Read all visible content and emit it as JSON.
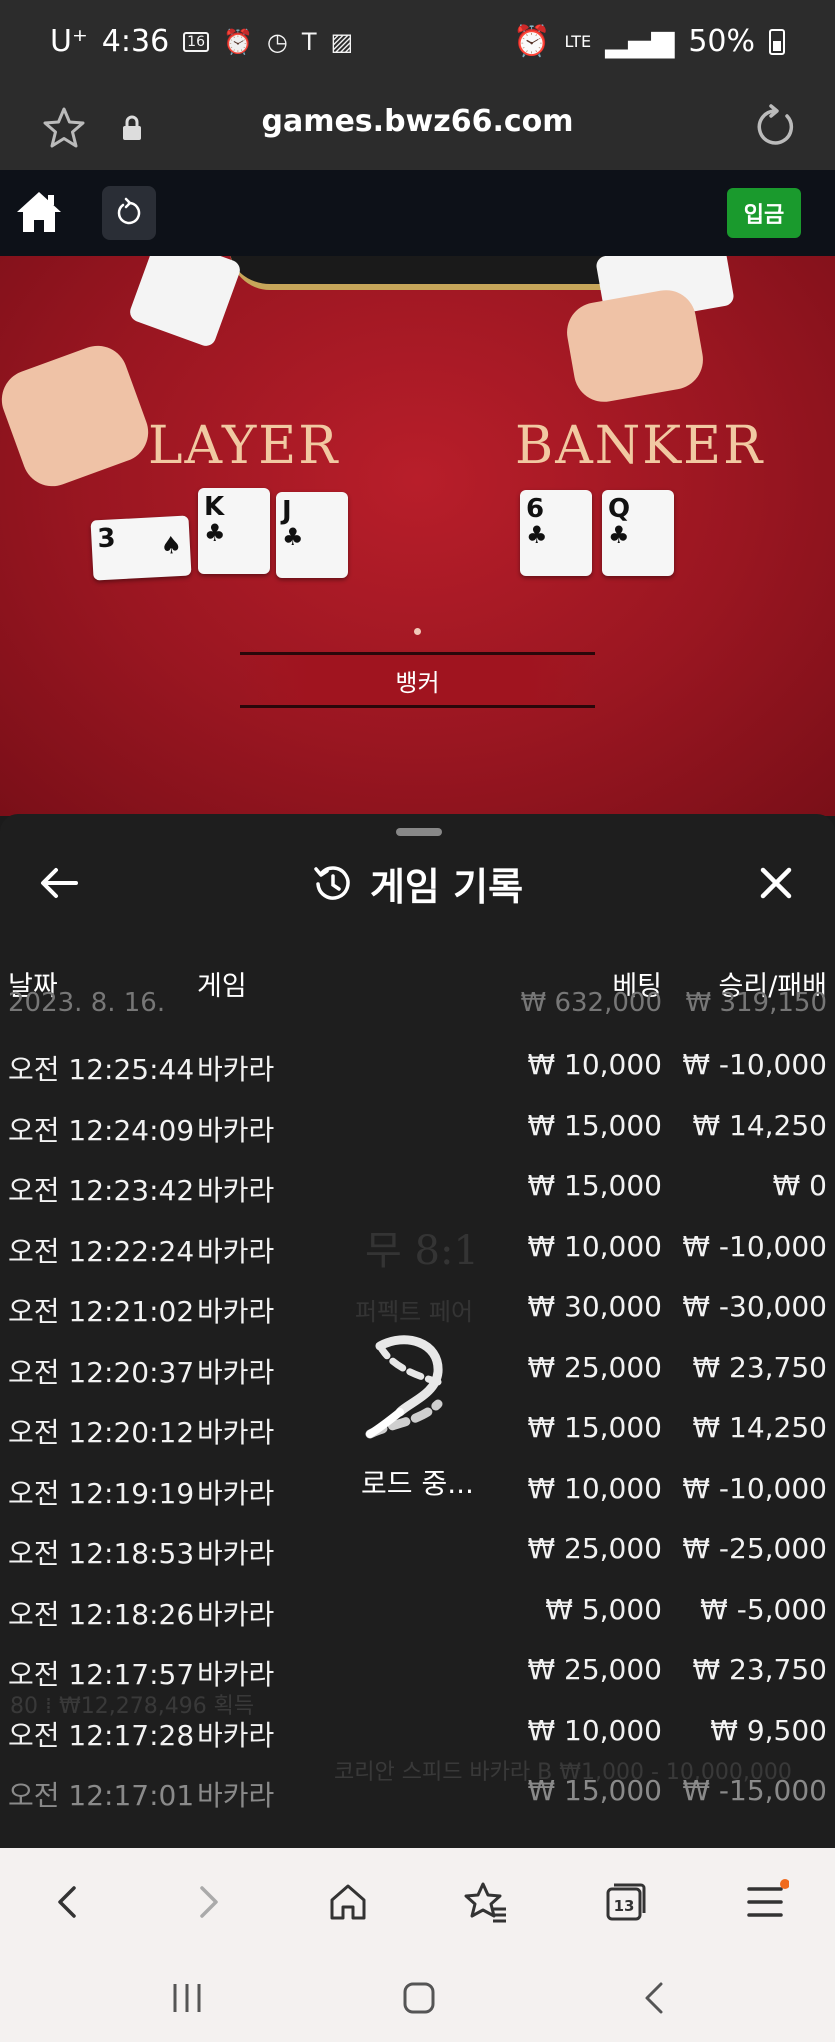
{
  "status_bar": {
    "carrier": "U⁺",
    "time": "4:36",
    "calendar_day": "16",
    "network": "LTE",
    "battery": "50%"
  },
  "browser": {
    "url": "games.bwz66.com"
  },
  "game_toolbar": {
    "deposit_label": "입금"
  },
  "video": {
    "player_label": "LAYER",
    "banker_label": "BANKER",
    "player_cards": [
      {
        "rank": "3",
        "suit": "♠"
      },
      {
        "rank": "K",
        "suit": "♣"
      },
      {
        "rank": "J",
        "suit": "♣"
      }
    ],
    "banker_cards": [
      {
        "rank": "6",
        "suit": "♣"
      },
      {
        "rank": "Q",
        "suit": "♣"
      }
    ],
    "result": "뱅커"
  },
  "history": {
    "title": "게임 기록",
    "columns": {
      "date": "날짜",
      "game": "게임",
      "bet": "베팅",
      "win_loss": "승리/패배"
    },
    "summary_row": {
      "date": "2023. 8. 16.",
      "bet": "₩ 632,000",
      "win_loss": "₩ 319,150"
    },
    "rows": [
      {
        "date": "오전 12:25:44",
        "game": "바카라",
        "bet": "₩ 10,000",
        "win_loss": "₩ -10,000"
      },
      {
        "date": "오전 12:24:09",
        "game": "바카라",
        "bet": "₩ 15,000",
        "win_loss": "₩ 14,250"
      },
      {
        "date": "오전 12:23:42",
        "game": "바카라",
        "bet": "₩ 15,000",
        "win_loss": "₩ 0"
      },
      {
        "date": "오전 12:22:24",
        "game": "바카라",
        "bet": "₩ 10,000",
        "win_loss": "₩ -10,000"
      },
      {
        "date": "오전 12:21:02",
        "game": "바카라",
        "bet": "₩ 30,000",
        "win_loss": "₩ -30,000"
      },
      {
        "date": "오전 12:20:37",
        "game": "바카라",
        "bet": "₩ 25,000",
        "win_loss": "₩ 23,750"
      },
      {
        "date": "오전 12:20:12",
        "game": "바카라",
        "bet": "₩ 15,000",
        "win_loss": "₩ 14,250"
      },
      {
        "date": "오전 12:19:19",
        "game": "바카라",
        "bet": "₩ 10,000",
        "win_loss": "₩ -10,000"
      },
      {
        "date": "오전 12:18:53",
        "game": "바카라",
        "bet": "₩ 25,000",
        "win_loss": "₩ -25,000"
      },
      {
        "date": "오전 12:18:26",
        "game": "바카라",
        "bet": "₩ 5,000",
        "win_loss": "₩ -5,000"
      },
      {
        "date": "오전 12:17:57",
        "game": "바카라",
        "bet": "₩ 25,000",
        "win_loss": "₩ 23,750"
      },
      {
        "date": "오전 12:17:28",
        "game": "바카라",
        "bet": "₩ 10,000",
        "win_loss": "₩ 9,500"
      },
      {
        "date": "오전 12:17:01",
        "game": "바카라",
        "bet": "₩ 15,000",
        "win_loss": "₩ -15,000"
      }
    ],
    "loading_text": "로드 중..."
  },
  "backdrop": {
    "tie_label": "무 8:1",
    "perfect_pair": "퍼펙트 페어",
    "players_count": "80 ⁞ ₩12,278,496 획득",
    "limits": "코리안 스피드 바카라 B ₩1,000 - 10,000,000"
  },
  "browser_nav": {
    "tabs_count": "13"
  }
}
